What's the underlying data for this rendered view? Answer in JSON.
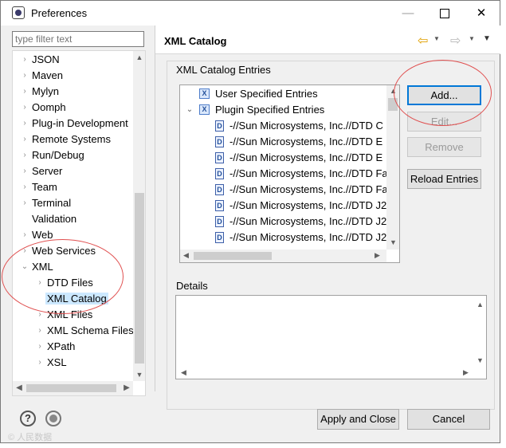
{
  "window": {
    "title": "Preferences",
    "minimize": "—",
    "maximize": "",
    "close": "✕"
  },
  "filter": {
    "placeholder": "type filter text"
  },
  "tree": {
    "items": [
      {
        "label": "JSON",
        "twisty": "›",
        "depth": 0
      },
      {
        "label": "Maven",
        "twisty": "›",
        "depth": 0
      },
      {
        "label": "Mylyn",
        "twisty": "›",
        "depth": 0
      },
      {
        "label": "Oomph",
        "twisty": "›",
        "depth": 0
      },
      {
        "label": "Plug-in Development",
        "twisty": "›",
        "depth": 0
      },
      {
        "label": "Remote Systems",
        "twisty": "›",
        "depth": 0
      },
      {
        "label": "Run/Debug",
        "twisty": "›",
        "depth": 0
      },
      {
        "label": "Server",
        "twisty": "›",
        "depth": 0
      },
      {
        "label": "Team",
        "twisty": "›",
        "depth": 0
      },
      {
        "label": "Terminal",
        "twisty": "›",
        "depth": 0
      },
      {
        "label": "Validation",
        "twisty": "",
        "depth": 0
      },
      {
        "label": "Web",
        "twisty": "›",
        "depth": 0
      },
      {
        "label": "Web Services",
        "twisty": "›",
        "depth": 0
      },
      {
        "label": "XML",
        "twisty": "⌄",
        "depth": 0
      },
      {
        "label": "DTD Files",
        "twisty": "›",
        "depth": 1
      },
      {
        "label": "XML Catalog",
        "twisty": "",
        "depth": 1,
        "selected": true
      },
      {
        "label": "XML Files",
        "twisty": "›",
        "depth": 1
      },
      {
        "label": "XML Schema Files",
        "twisty": "›",
        "depth": 1
      },
      {
        "label": "XPath",
        "twisty": "›",
        "depth": 1
      },
      {
        "label": "XSL",
        "twisty": "›",
        "depth": 1
      }
    ]
  },
  "page": {
    "title": "XML Catalog",
    "nav_back": "⇦",
    "nav_forward": "⇨",
    "dropdown": "▼",
    "menu": "▼"
  },
  "entries": {
    "group_label": "XML Catalog Entries",
    "user_entries": "User Specified Entries",
    "plugin_entries": "Plugin Specified Entries",
    "dtd_rows": [
      "-//Sun Microsystems, Inc.//DTD C",
      "-//Sun Microsystems, Inc.//DTD E",
      "-//Sun Microsystems, Inc.//DTD E",
      "-//Sun Microsystems, Inc.//DTD Fa",
      "-//Sun Microsystems, Inc.//DTD Fa",
      "-//Sun Microsystems, Inc.//DTD J2",
      "-//Sun Microsystems, Inc.//DTD J2",
      "-//Sun Microsystems, Inc.//DTD J2"
    ]
  },
  "buttons": {
    "add": "Add...",
    "edit": "Edit...",
    "remove": "Remove",
    "reload": "Reload Entries",
    "apply_close": "Apply and Close",
    "cancel": "Cancel"
  },
  "details": {
    "label": "Details"
  },
  "watermark": "© 人民数据"
}
